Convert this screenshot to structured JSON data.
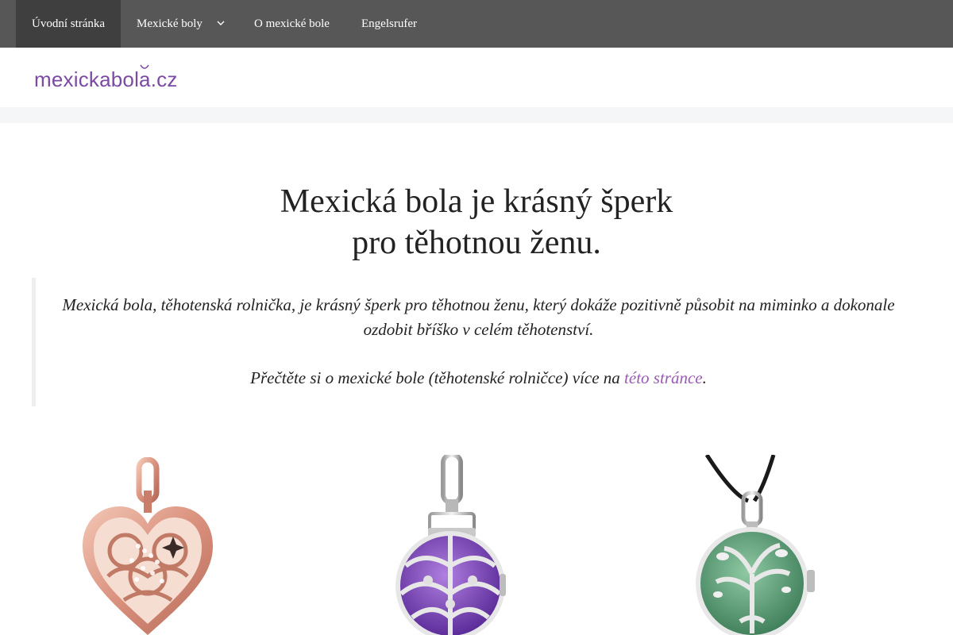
{
  "nav": {
    "items": [
      {
        "label": "Úvodní stránka",
        "active": true
      },
      {
        "label": "Mexické boly",
        "has_dropdown": true
      },
      {
        "label": "O mexické bole"
      },
      {
        "label": "Engelsrufer"
      }
    ]
  },
  "header": {
    "logo_text": "mexickabola.cz"
  },
  "hero": {
    "title_line1": "Mexická bola je krásný šperk",
    "title_line2": "pro těhotnou ženu."
  },
  "quote": {
    "paragraph1": "Mexická bola, těhotenská rolnička, je krásný šperk pro těhotnou ženu, který dokáže pozitivně působit na miminko a dokonale ozdobit bříško v celém těhotenství.",
    "paragraph2_prefix": "Přečtěte si o mexické bole (těhotenské rolničce) více na ",
    "paragraph2_link": "této stránce",
    "paragraph2_suffix": "."
  },
  "products": [
    {
      "icon": "rose-gold-heart-pendant"
    },
    {
      "icon": "silver-purple-ball-pendant"
    },
    {
      "icon": "silver-green-tree-ball-pendant"
    }
  ],
  "colors": {
    "nav_bg": "#575757",
    "nav_active_bg": "#3f3f3f",
    "accent": "#9b59b6",
    "logo": "#7b4ba3"
  }
}
